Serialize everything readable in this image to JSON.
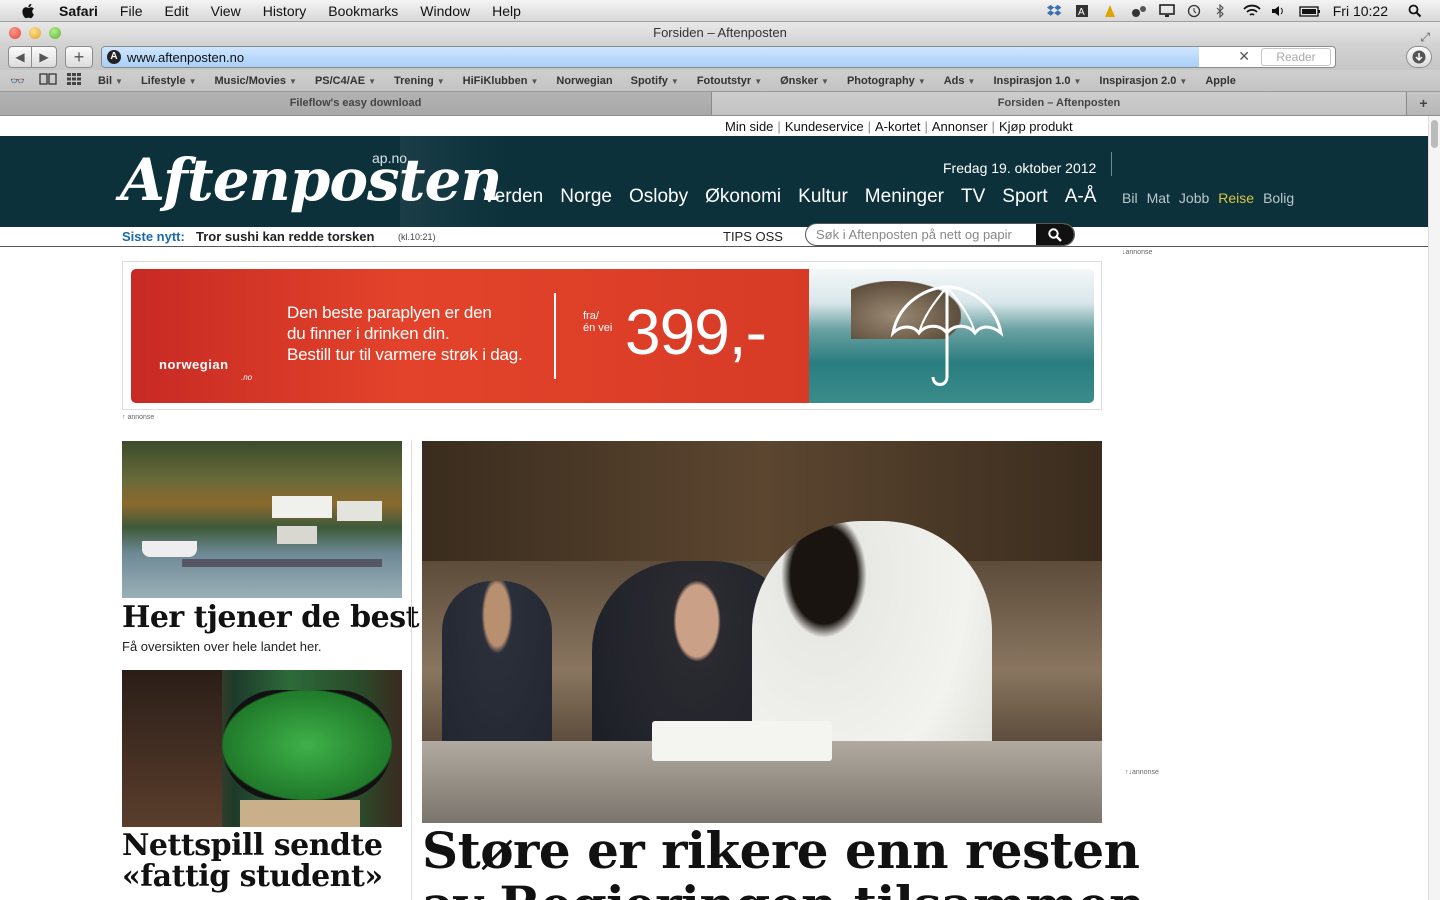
{
  "menubar": {
    "items": [
      "Safari",
      "File",
      "Edit",
      "View",
      "History",
      "Bookmarks",
      "Window",
      "Help"
    ],
    "clock": "Fri 10:22"
  },
  "window": {
    "title": "Forsiden – Aftenposten"
  },
  "toolbar": {
    "url": "www.aftenposten.no",
    "reader_label": "Reader",
    "load_progress": 0.89
  },
  "bookmarks": [
    {
      "label": "Bil",
      "menu": true
    },
    {
      "label": "Lifestyle",
      "menu": true
    },
    {
      "label": "Music/Movies",
      "menu": true
    },
    {
      "label": "PS/C4/AE",
      "menu": true
    },
    {
      "label": "Trening",
      "menu": true
    },
    {
      "label": "HiFiKlubben",
      "menu": true
    },
    {
      "label": "Norwegian",
      "menu": false
    },
    {
      "label": "Spotify",
      "menu": true
    },
    {
      "label": "Fotoutstyr",
      "menu": true
    },
    {
      "label": "Ønsker",
      "menu": true
    },
    {
      "label": "Photography",
      "menu": true
    },
    {
      "label": "Ads",
      "menu": true
    },
    {
      "label": "Inspirasjon 1.0",
      "menu": true
    },
    {
      "label": "Inspirasjon 2.0",
      "menu": true
    },
    {
      "label": "Apple",
      "menu": false
    }
  ],
  "tabs": [
    "Fileflow's easy download",
    "Forsiden – Aftenposten"
  ],
  "site": {
    "toplinks": [
      "Min side",
      "Kundeservice",
      "A-kortet",
      "Annonser",
      "Kjøp produkt"
    ],
    "logo": "Aftenposten",
    "logo_domain": "ap.no",
    "date": "Fredag 19. oktober 2012",
    "nav": [
      "Verden",
      "Norge",
      "Osloby",
      "Økonomi",
      "Kultur",
      "Meninger",
      "TV",
      "Sport",
      "A-Å"
    ],
    "subnav": [
      "Bil",
      "Mat",
      "Jobb",
      "Reise",
      "Bolig"
    ],
    "news_label": "Siste nytt:",
    "news_headline": "Tror sushi kan redde torsken",
    "news_time": "(kl.10:21)",
    "tips": "TIPS OSS",
    "search_placeholder": "Søk i Aftenposten på nett og papir",
    "ad_label_top": "↓annonse",
    "ad_label_bottom": "↑   annonse",
    "ad_label_side": "↑↓annonse"
  },
  "banner": {
    "message_lines": [
      "Den beste paraplyen er den",
      "du finner i drinken din.",
      "Bestill tur til varmere strøk i dag."
    ],
    "fra_line1": "fra/",
    "fra_line2": "én vei",
    "price": "399,-",
    "brand": "norwegian",
    "brand_sub": ".no"
  },
  "articles": [
    {
      "title": "Her tjener de best",
      "lead": "Få oversikten over hele landet her."
    },
    {
      "title_line1": "Nettspill sendte",
      "title_line2": "«fattig student»"
    },
    {
      "title_line1": "Støre er rikere enn resten",
      "title_line2": "av Regjeringen tilsammen"
    }
  ]
}
